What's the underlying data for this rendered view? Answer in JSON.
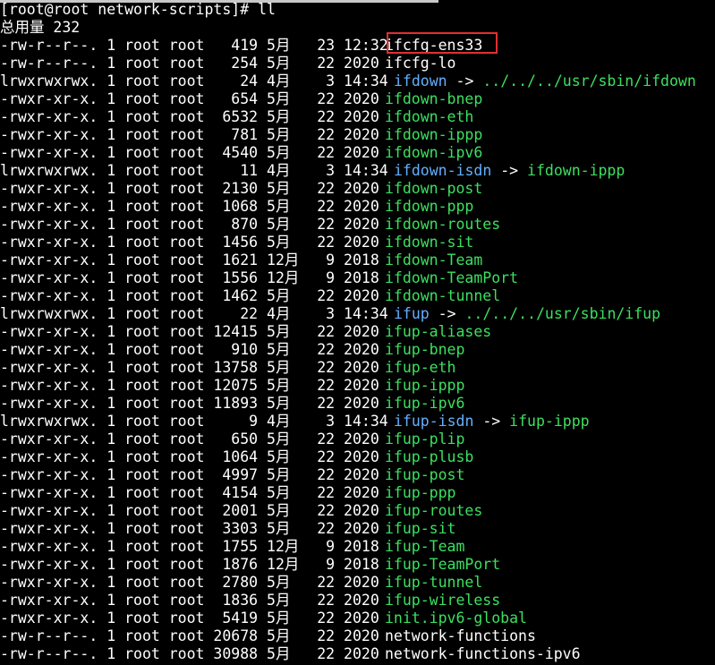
{
  "terminal": {
    "prompt": "[root@root network-scripts]# ll",
    "total": "总用量 232"
  },
  "colors": {
    "background": "#000000",
    "text": "#ffffff",
    "symlink": "#63b0ff",
    "executable": "#3ce060",
    "highlight": "#e03030"
  },
  "entries": [
    {
      "meta": "-rw-r--r--. 1 root root   419 5月   23 12:32",
      "name": "ifcfg-ens33",
      "target": "",
      "kind": "file"
    },
    {
      "meta": "-rw-r--r--. 1 root root   254 5月   22 2020",
      "name": "ifcfg-lo",
      "target": "",
      "kind": "file"
    },
    {
      "meta": "lrwxrwxrwx. 1 root root    24 4月    3 14:34",
      "name": "ifdown",
      "target": "../../../usr/sbin/ifdown",
      "kind": "link"
    },
    {
      "meta": "-rwxr-xr-x. 1 root root   654 5月   22 2020",
      "name": "ifdown-bnep",
      "target": "",
      "kind": "exec"
    },
    {
      "meta": "-rwxr-xr-x. 1 root root  6532 5月   22 2020",
      "name": "ifdown-eth",
      "target": "",
      "kind": "exec"
    },
    {
      "meta": "-rwxr-xr-x. 1 root root   781 5月   22 2020",
      "name": "ifdown-ippp",
      "target": "",
      "kind": "exec"
    },
    {
      "meta": "-rwxr-xr-x. 1 root root  4540 5月   22 2020",
      "name": "ifdown-ipv6",
      "target": "",
      "kind": "exec"
    },
    {
      "meta": "lrwxrwxrwx. 1 root root    11 4月    3 14:34",
      "name": "ifdown-isdn",
      "target": "ifdown-ippp",
      "kind": "link"
    },
    {
      "meta": "-rwxr-xr-x. 1 root root  2130 5月   22 2020",
      "name": "ifdown-post",
      "target": "",
      "kind": "exec"
    },
    {
      "meta": "-rwxr-xr-x. 1 root root  1068 5月   22 2020",
      "name": "ifdown-ppp",
      "target": "",
      "kind": "exec"
    },
    {
      "meta": "-rwxr-xr-x. 1 root root   870 5月   22 2020",
      "name": "ifdown-routes",
      "target": "",
      "kind": "exec"
    },
    {
      "meta": "-rwxr-xr-x. 1 root root  1456 5月   22 2020",
      "name": "ifdown-sit",
      "target": "",
      "kind": "exec"
    },
    {
      "meta": "-rwxr-xr-x. 1 root root  1621 12月   9 2018",
      "name": "ifdown-Team",
      "target": "",
      "kind": "exec"
    },
    {
      "meta": "-rwxr-xr-x. 1 root root  1556 12月   9 2018",
      "name": "ifdown-TeamPort",
      "target": "",
      "kind": "exec"
    },
    {
      "meta": "-rwxr-xr-x. 1 root root  1462 5月   22 2020",
      "name": "ifdown-tunnel",
      "target": "",
      "kind": "exec"
    },
    {
      "meta": "lrwxrwxrwx. 1 root root    22 4月    3 14:34",
      "name": "ifup",
      "target": "../../../usr/sbin/ifup",
      "kind": "link"
    },
    {
      "meta": "-rwxr-xr-x. 1 root root 12415 5月   22 2020",
      "name": "ifup-aliases",
      "target": "",
      "kind": "exec"
    },
    {
      "meta": "-rwxr-xr-x. 1 root root   910 5月   22 2020",
      "name": "ifup-bnep",
      "target": "",
      "kind": "exec"
    },
    {
      "meta": "-rwxr-xr-x. 1 root root 13758 5月   22 2020",
      "name": "ifup-eth",
      "target": "",
      "kind": "exec"
    },
    {
      "meta": "-rwxr-xr-x. 1 root root 12075 5月   22 2020",
      "name": "ifup-ippp",
      "target": "",
      "kind": "exec"
    },
    {
      "meta": "-rwxr-xr-x. 1 root root 11893 5月   22 2020",
      "name": "ifup-ipv6",
      "target": "",
      "kind": "exec"
    },
    {
      "meta": "lrwxrwxrwx. 1 root root     9 4月    3 14:34",
      "name": "ifup-isdn",
      "target": "ifup-ippp",
      "kind": "link"
    },
    {
      "meta": "-rwxr-xr-x. 1 root root   650 5月   22 2020",
      "name": "ifup-plip",
      "target": "",
      "kind": "exec"
    },
    {
      "meta": "-rwxr-xr-x. 1 root root  1064 5月   22 2020",
      "name": "ifup-plusb",
      "target": "",
      "kind": "exec"
    },
    {
      "meta": "-rwxr-xr-x. 1 root root  4997 5月   22 2020",
      "name": "ifup-post",
      "target": "",
      "kind": "exec"
    },
    {
      "meta": "-rwxr-xr-x. 1 root root  4154 5月   22 2020",
      "name": "ifup-ppp",
      "target": "",
      "kind": "exec"
    },
    {
      "meta": "-rwxr-xr-x. 1 root root  2001 5月   22 2020",
      "name": "ifup-routes",
      "target": "",
      "kind": "exec"
    },
    {
      "meta": "-rwxr-xr-x. 1 root root  3303 5月   22 2020",
      "name": "ifup-sit",
      "target": "",
      "kind": "exec"
    },
    {
      "meta": "-rwxr-xr-x. 1 root root  1755 12月   9 2018",
      "name": "ifup-Team",
      "target": "",
      "kind": "exec"
    },
    {
      "meta": "-rwxr-xr-x. 1 root root  1876 12月   9 2018",
      "name": "ifup-TeamPort",
      "target": "",
      "kind": "exec"
    },
    {
      "meta": "-rwxr-xr-x. 1 root root  2780 5月   22 2020",
      "name": "ifup-tunnel",
      "target": "",
      "kind": "exec"
    },
    {
      "meta": "-rwxr-xr-x. 1 root root  1836 5月   22 2020",
      "name": "ifup-wireless",
      "target": "",
      "kind": "exec"
    },
    {
      "meta": "-rwxr-xr-x. 1 root root  5419 5月   22 2020",
      "name": "init.ipv6-global",
      "target": "",
      "kind": "exec"
    },
    {
      "meta": "-rw-r--r--. 1 root root 20678 5月   22 2020",
      "name": "network-functions",
      "target": "",
      "kind": "file"
    },
    {
      "meta": "-rw-r--r--. 1 root root 30988 5月   22 2020",
      "name": "network-functions-ipv6",
      "target": "",
      "kind": "file"
    }
  ]
}
